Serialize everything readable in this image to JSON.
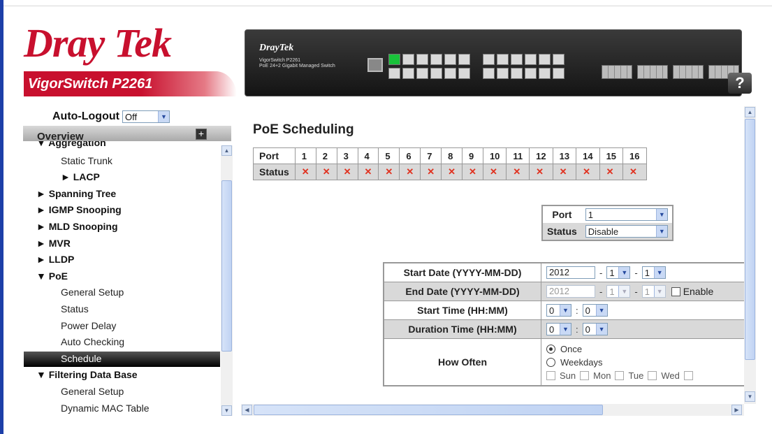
{
  "brand": {
    "logo_part1": "Dray",
    "logo_part2": "Tek",
    "model_name": "VigorSwitch P2261",
    "device_brand": "DrayTek",
    "device_model": "VigorSwitch P2261",
    "device_model_sub": "PoE 24+2 Gigabit Managed Switch",
    "help_label": "?"
  },
  "autologout": {
    "label": "Auto-Logout",
    "value": "Off"
  },
  "sidebar": {
    "overview_label": "Overview",
    "items": [
      {
        "label": "▼ Aggregation",
        "bold": true
      },
      {
        "label": "Static Trunk",
        "bold": false
      },
      {
        "label": "► LACP",
        "bold": true
      },
      {
        "label": "► Spanning Tree",
        "bold": true
      },
      {
        "label": "► IGMP Snooping",
        "bold": true
      },
      {
        "label": "► MLD Snooping",
        "bold": true
      },
      {
        "label": "► MVR",
        "bold": true
      },
      {
        "label": "► LLDP",
        "bold": true
      },
      {
        "label": "▼ PoE",
        "bold": true
      },
      {
        "label": "General Setup",
        "bold": false
      },
      {
        "label": "Status",
        "bold": false
      },
      {
        "label": "Power Delay",
        "bold": false
      },
      {
        "label": "Auto Checking",
        "bold": false
      },
      {
        "label": "Schedule",
        "bold": false,
        "selected": true
      },
      {
        "label": "▼ Filtering Data Base",
        "bold": true
      },
      {
        "label": "General Setup",
        "bold": false
      },
      {
        "label": "Dynamic MAC Table",
        "bold": false
      }
    ]
  },
  "main": {
    "title": "PoE Scheduling",
    "port_status": {
      "port_header": "Port",
      "status_header": "Status",
      "ports": [
        "1",
        "2",
        "3",
        "4",
        "5",
        "6",
        "7",
        "8",
        "9",
        "10",
        "11",
        "12",
        "13",
        "14",
        "15",
        "16"
      ],
      "status_symbol": "✕"
    },
    "port_select": {
      "port_label": "Port",
      "port_value": "1",
      "status_label": "Status",
      "status_value": "Disable"
    },
    "schedule": {
      "start_date_label": "Start Date (YYYY-MM-DD)",
      "start_year": "2012",
      "start_month": "1",
      "start_day": "1",
      "end_date_label": "End Date (YYYY-MM-DD)",
      "end_year": "2012",
      "end_month": "1",
      "end_day": "1",
      "enable_label": "Enable",
      "start_time_label": "Start Time (HH:MM)",
      "start_hour": "0",
      "start_min": "0",
      "duration_label": "Duration Time (HH:MM)",
      "duration_hour": "0",
      "duration_min": "0",
      "how_often_label": "How Often",
      "once_label": "Once",
      "weekdays_label": "Weekdays",
      "days": [
        "Sun",
        "Mon",
        "Tue",
        "Wed"
      ],
      "separator": "-",
      "time_separator": ":"
    }
  },
  "colors": {
    "brand_red": "#c8102e",
    "status_x": "#e0311f",
    "selected_nav": "#000000"
  }
}
